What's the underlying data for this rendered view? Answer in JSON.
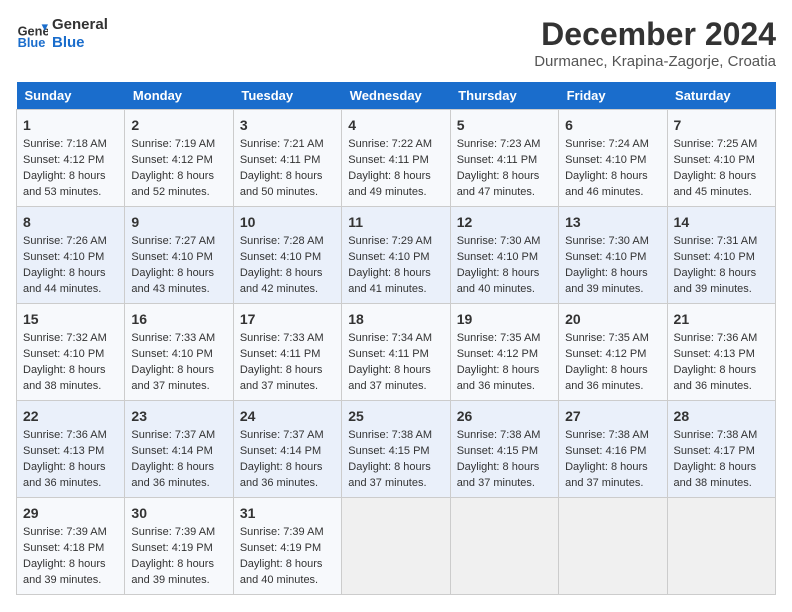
{
  "header": {
    "logo_line1": "General",
    "logo_line2": "Blue",
    "title": "December 2024",
    "subtitle": "Durmanec, Krapina-Zagorje, Croatia"
  },
  "days_of_week": [
    "Sunday",
    "Monday",
    "Tuesday",
    "Wednesday",
    "Thursday",
    "Friday",
    "Saturday"
  ],
  "weeks": [
    [
      {
        "day": "1",
        "sunrise": "Sunrise: 7:18 AM",
        "sunset": "Sunset: 4:12 PM",
        "daylight": "Daylight: 8 hours and 53 minutes."
      },
      {
        "day": "2",
        "sunrise": "Sunrise: 7:19 AM",
        "sunset": "Sunset: 4:12 PM",
        "daylight": "Daylight: 8 hours and 52 minutes."
      },
      {
        "day": "3",
        "sunrise": "Sunrise: 7:21 AM",
        "sunset": "Sunset: 4:11 PM",
        "daylight": "Daylight: 8 hours and 50 minutes."
      },
      {
        "day": "4",
        "sunrise": "Sunrise: 7:22 AM",
        "sunset": "Sunset: 4:11 PM",
        "daylight": "Daylight: 8 hours and 49 minutes."
      },
      {
        "day": "5",
        "sunrise": "Sunrise: 7:23 AM",
        "sunset": "Sunset: 4:11 PM",
        "daylight": "Daylight: 8 hours and 47 minutes."
      },
      {
        "day": "6",
        "sunrise": "Sunrise: 7:24 AM",
        "sunset": "Sunset: 4:10 PM",
        "daylight": "Daylight: 8 hours and 46 minutes."
      },
      {
        "day": "7",
        "sunrise": "Sunrise: 7:25 AM",
        "sunset": "Sunset: 4:10 PM",
        "daylight": "Daylight: 8 hours and 45 minutes."
      }
    ],
    [
      {
        "day": "8",
        "sunrise": "Sunrise: 7:26 AM",
        "sunset": "Sunset: 4:10 PM",
        "daylight": "Daylight: 8 hours and 44 minutes."
      },
      {
        "day": "9",
        "sunrise": "Sunrise: 7:27 AM",
        "sunset": "Sunset: 4:10 PM",
        "daylight": "Daylight: 8 hours and 43 minutes."
      },
      {
        "day": "10",
        "sunrise": "Sunrise: 7:28 AM",
        "sunset": "Sunset: 4:10 PM",
        "daylight": "Daylight: 8 hours and 42 minutes."
      },
      {
        "day": "11",
        "sunrise": "Sunrise: 7:29 AM",
        "sunset": "Sunset: 4:10 PM",
        "daylight": "Daylight: 8 hours and 41 minutes."
      },
      {
        "day": "12",
        "sunrise": "Sunrise: 7:30 AM",
        "sunset": "Sunset: 4:10 PM",
        "daylight": "Daylight: 8 hours and 40 minutes."
      },
      {
        "day": "13",
        "sunrise": "Sunrise: 7:30 AM",
        "sunset": "Sunset: 4:10 PM",
        "daylight": "Daylight: 8 hours and 39 minutes."
      },
      {
        "day": "14",
        "sunrise": "Sunrise: 7:31 AM",
        "sunset": "Sunset: 4:10 PM",
        "daylight": "Daylight: 8 hours and 39 minutes."
      }
    ],
    [
      {
        "day": "15",
        "sunrise": "Sunrise: 7:32 AM",
        "sunset": "Sunset: 4:10 PM",
        "daylight": "Daylight: 8 hours and 38 minutes."
      },
      {
        "day": "16",
        "sunrise": "Sunrise: 7:33 AM",
        "sunset": "Sunset: 4:10 PM",
        "daylight": "Daylight: 8 hours and 37 minutes."
      },
      {
        "day": "17",
        "sunrise": "Sunrise: 7:33 AM",
        "sunset": "Sunset: 4:11 PM",
        "daylight": "Daylight: 8 hours and 37 minutes."
      },
      {
        "day": "18",
        "sunrise": "Sunrise: 7:34 AM",
        "sunset": "Sunset: 4:11 PM",
        "daylight": "Daylight: 8 hours and 37 minutes."
      },
      {
        "day": "19",
        "sunrise": "Sunrise: 7:35 AM",
        "sunset": "Sunset: 4:12 PM",
        "daylight": "Daylight: 8 hours and 36 minutes."
      },
      {
        "day": "20",
        "sunrise": "Sunrise: 7:35 AM",
        "sunset": "Sunset: 4:12 PM",
        "daylight": "Daylight: 8 hours and 36 minutes."
      },
      {
        "day": "21",
        "sunrise": "Sunrise: 7:36 AM",
        "sunset": "Sunset: 4:13 PM",
        "daylight": "Daylight: 8 hours and 36 minutes."
      }
    ],
    [
      {
        "day": "22",
        "sunrise": "Sunrise: 7:36 AM",
        "sunset": "Sunset: 4:13 PM",
        "daylight": "Daylight: 8 hours and 36 minutes."
      },
      {
        "day": "23",
        "sunrise": "Sunrise: 7:37 AM",
        "sunset": "Sunset: 4:14 PM",
        "daylight": "Daylight: 8 hours and 36 minutes."
      },
      {
        "day": "24",
        "sunrise": "Sunrise: 7:37 AM",
        "sunset": "Sunset: 4:14 PM",
        "daylight": "Daylight: 8 hours and 36 minutes."
      },
      {
        "day": "25",
        "sunrise": "Sunrise: 7:38 AM",
        "sunset": "Sunset: 4:15 PM",
        "daylight": "Daylight: 8 hours and 37 minutes."
      },
      {
        "day": "26",
        "sunrise": "Sunrise: 7:38 AM",
        "sunset": "Sunset: 4:15 PM",
        "daylight": "Daylight: 8 hours and 37 minutes."
      },
      {
        "day": "27",
        "sunrise": "Sunrise: 7:38 AM",
        "sunset": "Sunset: 4:16 PM",
        "daylight": "Daylight: 8 hours and 37 minutes."
      },
      {
        "day": "28",
        "sunrise": "Sunrise: 7:38 AM",
        "sunset": "Sunset: 4:17 PM",
        "daylight": "Daylight: 8 hours and 38 minutes."
      }
    ],
    [
      {
        "day": "29",
        "sunrise": "Sunrise: 7:39 AM",
        "sunset": "Sunset: 4:18 PM",
        "daylight": "Daylight: 8 hours and 39 minutes."
      },
      {
        "day": "30",
        "sunrise": "Sunrise: 7:39 AM",
        "sunset": "Sunset: 4:19 PM",
        "daylight": "Daylight: 8 hours and 39 minutes."
      },
      {
        "day": "31",
        "sunrise": "Sunrise: 7:39 AM",
        "sunset": "Sunset: 4:19 PM",
        "daylight": "Daylight: 8 hours and 40 minutes."
      },
      null,
      null,
      null,
      null
    ]
  ]
}
